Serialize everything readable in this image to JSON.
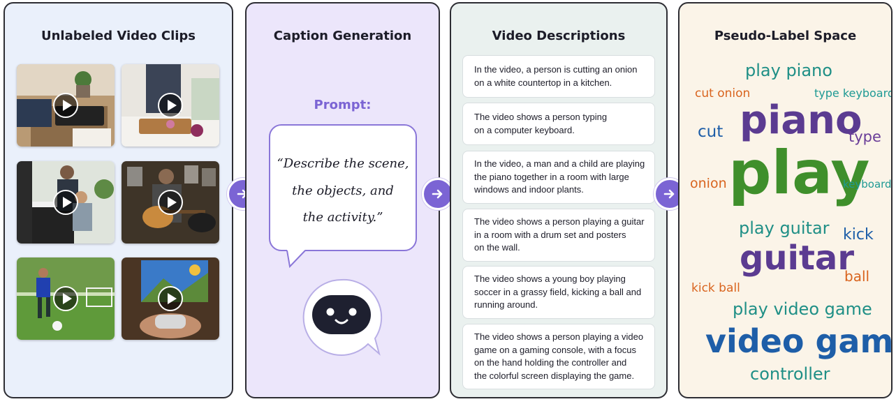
{
  "panels": {
    "clips_title": "Unlabeled Video Clips",
    "caption_title": "Caption Generation",
    "descriptions_title": "Video Descriptions",
    "pseudo_title": "Pseudo-Label Space"
  },
  "prompt": {
    "label": "Prompt:",
    "lines": [
      "“Describe the scene,",
      "the objects, and",
      "the activity.”"
    ]
  },
  "descriptions": [
    [
      "In the video, a person is cutting an onion",
      "on a white countertop in a kitchen."
    ],
    [
      "The video shows a person typing",
      "on a computer keyboard."
    ],
    [
      "In the video, a man and a child are playing",
      "the piano together in a room with large",
      "windows and indoor plants."
    ],
    [
      "The video shows a person playing a guitar",
      "in a room with a drum set and posters",
      "on the wall."
    ],
    [
      "The video shows a young boy playing",
      "soccer in a grassy field, kicking a ball and",
      "running around."
    ],
    [
      "The video shows a person playing a video",
      "game on a gaming console, with a focus",
      "on the hand holding the controller and",
      "the colorful screen displaying the game."
    ]
  ],
  "word_cloud": [
    {
      "text": "play piano",
      "color": "#1f8f86"
    },
    {
      "text": "cut onion",
      "color": "#d9641e"
    },
    {
      "text": "type keyboard",
      "color": "#1f9a94"
    },
    {
      "text": "cut",
      "color": "#1e5ea8"
    },
    {
      "text": "piano",
      "color": "#5b3b91"
    },
    {
      "text": "type",
      "color": "#6a3d98"
    },
    {
      "text": "onion",
      "color": "#d9641e"
    },
    {
      "text": "play",
      "color": "#3f8f2b"
    },
    {
      "text": "keyboard",
      "color": "#1f9a94"
    },
    {
      "text": "play guitar",
      "color": "#1f8f86"
    },
    {
      "text": "kick",
      "color": "#1e5ea8"
    },
    {
      "text": "guitar",
      "color": "#5b3b91"
    },
    {
      "text": "ball",
      "color": "#d9641e"
    },
    {
      "text": "kick ball",
      "color": "#d9641e"
    },
    {
      "text": "play video game",
      "color": "#1f8f86"
    },
    {
      "text": "video game",
      "color": "#1e5ea8"
    },
    {
      "text": "controller",
      "color": "#1f8f86"
    }
  ],
  "colors": {
    "accent": "#7b64d4",
    "border": "#2d2d33"
  },
  "icons": [
    "play-icon",
    "arrow-right-icon",
    "chatbot-icon"
  ]
}
